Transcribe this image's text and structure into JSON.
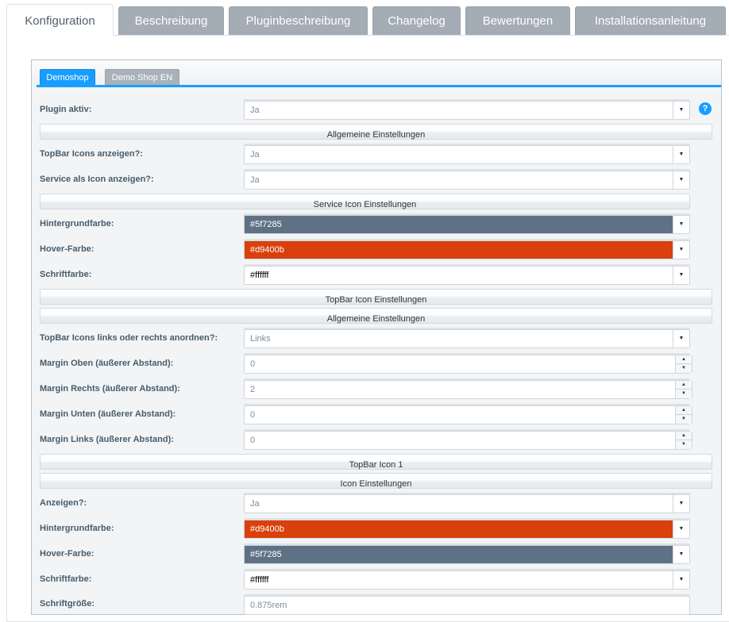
{
  "top_tabs": [
    "Konfiguration",
    "Beschreibung",
    "Pluginbeschreibung",
    "Changelog",
    "Bewertungen",
    "Installationsanleitung"
  ],
  "shop_tabs": [
    "Demoshop",
    "Demo Shop EN"
  ],
  "help_icon": "?",
  "rows": {
    "plugin_aktiv": {
      "label": "Plugin aktiv:",
      "value": "Ja"
    },
    "sep1": "Allgemeine Einstellungen",
    "topbar_icons": {
      "label": "TopBar Icons anzeigen?:",
      "value": "Ja"
    },
    "service_icon": {
      "label": "Service als Icon anzeigen?:",
      "value": "Ja"
    },
    "sep2": "Service Icon Einstellungen",
    "bg1": {
      "label": "Hintergrundfarbe:",
      "value": "#5f7285",
      "color": "#5f7285"
    },
    "hover1": {
      "label": "Hover-Farbe:",
      "value": "#d9400b",
      "color": "#d9400b"
    },
    "font1": {
      "label": "Schriftfarbe:",
      "value": "#ffffff",
      "color": "#ffffff"
    },
    "sep3": "TopBar Icon Einstellungen",
    "sep4": "Allgemeine Einstellungen",
    "align": {
      "label": "TopBar Icons links oder rechts anordnen?:",
      "value": "Links"
    },
    "m_top": {
      "label": "Margin Oben (äußerer Abstand):",
      "value": "0"
    },
    "m_right": {
      "label": "Margin Rechts (äußerer Abstand):",
      "value": "2"
    },
    "m_bottom": {
      "label": "Margin Unten (äußerer Abstand):",
      "value": "0"
    },
    "m_left": {
      "label": "Margin Links (äußerer Abstand):",
      "value": "0"
    },
    "sep5": "TopBar Icon 1",
    "sep6": "Icon Einstellungen",
    "show": {
      "label": "Anzeigen?:",
      "value": "Ja"
    },
    "bg2": {
      "label": "Hintergrundfarbe:",
      "value": "#d9400b",
      "color": "#d9400b"
    },
    "hover2": {
      "label": "Hover-Farbe:",
      "value": "#5f7285",
      "color": "#5f7285"
    },
    "font2": {
      "label": "Schriftfarbe:",
      "value": "#ffffff",
      "color": "#ffffff"
    },
    "fontsize": {
      "label": "Schriftgröße:",
      "value": "0.875rem"
    }
  },
  "colors": {
    "accent": "#189eff",
    "tab_inactive": "#a4acb5"
  }
}
